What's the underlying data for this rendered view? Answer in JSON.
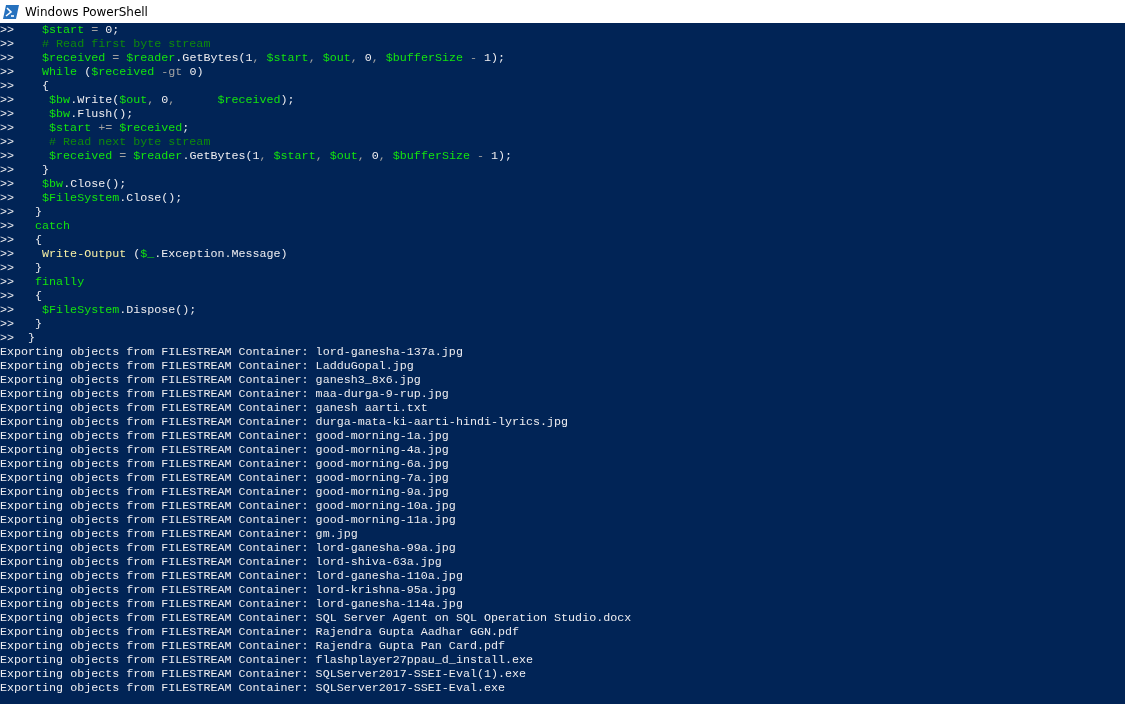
{
  "window": {
    "title": "Windows PowerShell"
  },
  "code_lines": [
    {
      "prompt": ">>",
      "tokens": [
        {
          "kind": "variable",
          "text": "    $start"
        },
        {
          "kind": "operator",
          "text": " = "
        },
        {
          "kind": "plain",
          "text": "0;"
        }
      ]
    },
    {
      "prompt": ">>",
      "tokens": [
        {
          "kind": "comment",
          "text": "    # Read first byte stream"
        }
      ]
    },
    {
      "prompt": ">>",
      "tokens": [
        {
          "kind": "variable",
          "text": "    $received"
        },
        {
          "kind": "operator",
          "text": " = "
        },
        {
          "kind": "variable",
          "text": "$reader"
        },
        {
          "kind": "plain",
          "text": ".GetBytes(1"
        },
        {
          "kind": "operator",
          "text": ", "
        },
        {
          "kind": "variable",
          "text": "$start"
        },
        {
          "kind": "operator",
          "text": ", "
        },
        {
          "kind": "variable",
          "text": "$out"
        },
        {
          "kind": "operator",
          "text": ", "
        },
        {
          "kind": "plain",
          "text": "0"
        },
        {
          "kind": "operator",
          "text": ", "
        },
        {
          "kind": "variable",
          "text": "$bufferSize"
        },
        {
          "kind": "operator",
          "text": " - "
        },
        {
          "kind": "plain",
          "text": "1);"
        }
      ]
    },
    {
      "prompt": ">>",
      "tokens": [
        {
          "kind": "keyword",
          "text": "    While"
        },
        {
          "kind": "plain",
          "text": " ("
        },
        {
          "kind": "variable",
          "text": "$received"
        },
        {
          "kind": "operator",
          "text": " -gt "
        },
        {
          "kind": "plain",
          "text": "0)"
        }
      ]
    },
    {
      "prompt": ">>",
      "tokens": [
        {
          "kind": "plain",
          "text": "    {"
        }
      ]
    },
    {
      "prompt": ">>",
      "tokens": [
        {
          "kind": "variable",
          "text": "     $bw"
        },
        {
          "kind": "plain",
          "text": ".Write("
        },
        {
          "kind": "variable",
          "text": "$out"
        },
        {
          "kind": "operator",
          "text": ", "
        },
        {
          "kind": "plain",
          "text": "0"
        },
        {
          "kind": "operator",
          "text": ",      "
        },
        {
          "kind": "variable",
          "text": "$received"
        },
        {
          "kind": "plain",
          "text": ");"
        }
      ]
    },
    {
      "prompt": ">>",
      "tokens": [
        {
          "kind": "variable",
          "text": "     $bw"
        },
        {
          "kind": "plain",
          "text": ".Flush();"
        }
      ]
    },
    {
      "prompt": ">>",
      "tokens": [
        {
          "kind": "variable",
          "text": "     $start"
        },
        {
          "kind": "operator",
          "text": " += "
        },
        {
          "kind": "variable",
          "text": "$received"
        },
        {
          "kind": "plain",
          "text": ";"
        }
      ]
    },
    {
      "prompt": ">>",
      "tokens": [
        {
          "kind": "comment",
          "text": "     # Read next byte stream"
        }
      ]
    },
    {
      "prompt": ">>",
      "tokens": [
        {
          "kind": "variable",
          "text": "     $received"
        },
        {
          "kind": "operator",
          "text": " = "
        },
        {
          "kind": "variable",
          "text": "$reader"
        },
        {
          "kind": "plain",
          "text": ".GetBytes(1"
        },
        {
          "kind": "operator",
          "text": ", "
        },
        {
          "kind": "variable",
          "text": "$start"
        },
        {
          "kind": "operator",
          "text": ", "
        },
        {
          "kind": "variable",
          "text": "$out"
        },
        {
          "kind": "operator",
          "text": ", "
        },
        {
          "kind": "plain",
          "text": "0"
        },
        {
          "kind": "operator",
          "text": ", "
        },
        {
          "kind": "variable",
          "text": "$bufferSize"
        },
        {
          "kind": "operator",
          "text": " - "
        },
        {
          "kind": "plain",
          "text": "1);"
        }
      ]
    },
    {
      "prompt": ">>",
      "tokens": [
        {
          "kind": "plain",
          "text": "    }"
        }
      ]
    },
    {
      "prompt": ">>",
      "tokens": [
        {
          "kind": "variable",
          "text": "    $bw"
        },
        {
          "kind": "plain",
          "text": ".Close();"
        }
      ]
    },
    {
      "prompt": ">>",
      "tokens": [
        {
          "kind": "variable",
          "text": "    $FileSystem"
        },
        {
          "kind": "plain",
          "text": ".Close();"
        }
      ]
    },
    {
      "prompt": ">>",
      "tokens": [
        {
          "kind": "plain",
          "text": "   }"
        }
      ]
    },
    {
      "prompt": ">>",
      "tokens": [
        {
          "kind": "keyword",
          "text": "   catch"
        }
      ]
    },
    {
      "prompt": ">>",
      "tokens": [
        {
          "kind": "plain",
          "text": "   {"
        }
      ]
    },
    {
      "prompt": ">>",
      "tokens": [
        {
          "kind": "command",
          "text": "    Write-Output"
        },
        {
          "kind": "plain",
          "text": " ("
        },
        {
          "kind": "variable",
          "text": "$_"
        },
        {
          "kind": "plain",
          "text": ".Exception.Message)"
        }
      ]
    },
    {
      "prompt": ">>",
      "tokens": [
        {
          "kind": "plain",
          "text": "   }"
        }
      ]
    },
    {
      "prompt": ">>",
      "tokens": [
        {
          "kind": "keyword",
          "text": "   finally"
        }
      ]
    },
    {
      "prompt": ">>",
      "tokens": [
        {
          "kind": "plain",
          "text": "   {"
        }
      ]
    },
    {
      "prompt": ">>",
      "tokens": [
        {
          "kind": "variable",
          "text": "    $FileSystem"
        },
        {
          "kind": "plain",
          "text": ".Dispose();"
        }
      ]
    },
    {
      "prompt": ">>",
      "tokens": [
        {
          "kind": "plain",
          "text": "   }"
        }
      ]
    },
    {
      "prompt": ">>",
      "tokens": [
        {
          "kind": "plain",
          "text": "  }"
        }
      ]
    }
  ],
  "output_lines": [
    "Exporting objects from FILESTREAM Container: lord-ganesha-137a.jpg",
    "Exporting objects from FILESTREAM Container: LadduGopal.jpg",
    "Exporting objects from FILESTREAM Container: ganesh3_8x6.jpg",
    "Exporting objects from FILESTREAM Container: maa-durga-9-rup.jpg",
    "Exporting objects from FILESTREAM Container: ganesh aarti.txt",
    "Exporting objects from FILESTREAM Container: durga-mata-ki-aarti-hindi-lyrics.jpg",
    "Exporting objects from FILESTREAM Container: good-morning-1a.jpg",
    "Exporting objects from FILESTREAM Container: good-morning-4a.jpg",
    "Exporting objects from FILESTREAM Container: good-morning-6a.jpg",
    "Exporting objects from FILESTREAM Container: good-morning-7a.jpg",
    "Exporting objects from FILESTREAM Container: good-morning-9a.jpg",
    "Exporting objects from FILESTREAM Container: good-morning-10a.jpg",
    "Exporting objects from FILESTREAM Container: good-morning-11a.jpg",
    "Exporting objects from FILESTREAM Container: gm.jpg",
    "Exporting objects from FILESTREAM Container: lord-ganesha-99a.jpg",
    "Exporting objects from FILESTREAM Container: lord-shiva-63a.jpg",
    "Exporting objects from FILESTREAM Container: lord-ganesha-110a.jpg",
    "Exporting objects from FILESTREAM Container: lord-krishna-95a.jpg",
    "Exporting objects from FILESTREAM Container: lord-ganesha-114a.jpg",
    "Exporting objects from FILESTREAM Container: SQL Server Agent on SQL Operation Studio.docx",
    "Exporting objects from FILESTREAM Container: Rajendra Gupta Aadhar GGN.pdf",
    "Exporting objects from FILESTREAM Container: Rajendra Gupta Pan Card.pdf",
    "Exporting objects from FILESTREAM Container: flashplayer27ppau_d_install.exe",
    "Exporting objects from FILESTREAM Container: SQLServer2017-SSEI-Eval(1).exe",
    "Exporting objects from FILESTREAM Container: SQLServer2017-SSEI-Eval.exe"
  ]
}
